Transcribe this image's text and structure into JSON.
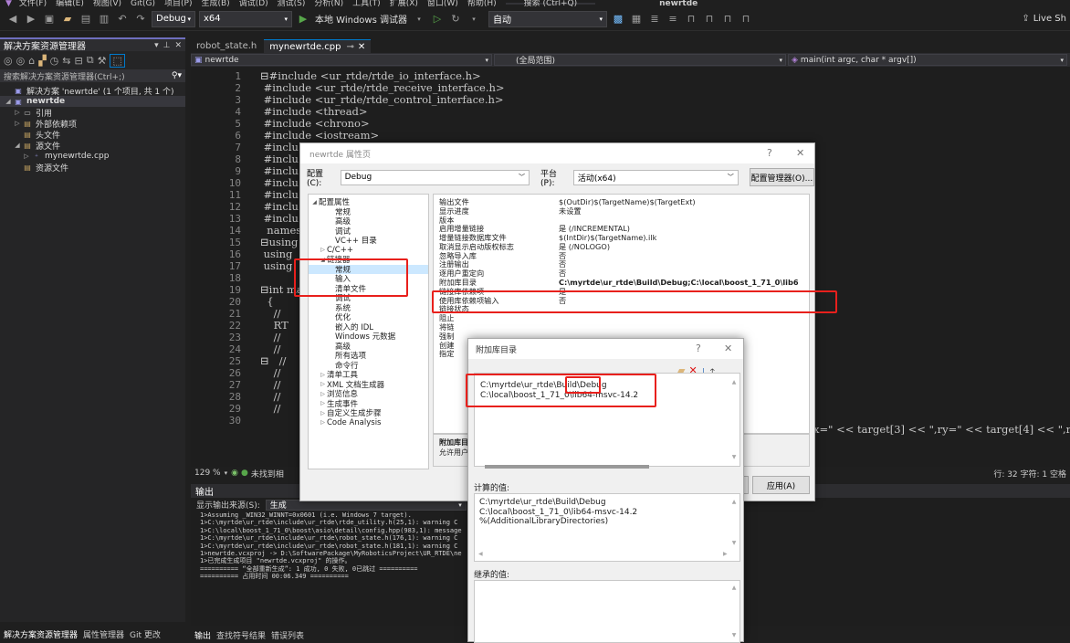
{
  "menubar": {
    "items": [
      "文件(F)",
      "编辑(E)",
      "视图(V)",
      "Git(G)",
      "项目(P)",
      "生成(B)",
      "调试(D)",
      "测试(S)",
      "分析(N)",
      "工具(T)",
      "扩展(X)",
      "窗口(W)",
      "帮助(H)",
      "搜索 (Ctrl+Q)",
      "newrtde"
    ]
  },
  "toolbar": {
    "config": "Debug",
    "platform": "x64",
    "run_label": "本地 Windows 调试器",
    "auto": "自动",
    "liveshare": "Live Sh"
  },
  "solution": {
    "title": "解决方案资源管理器",
    "search_placeholder": "搜索解决方案资源管理器(Ctrl+;)",
    "items": [
      {
        "label": "解决方案 'newrtde' (1 个项目, 共 1 个)",
        "indent": 0,
        "toggle": "",
        "bold": false
      },
      {
        "label": "newrtde",
        "indent": 0,
        "toggle": "◢",
        "bold": true
      },
      {
        "label": "引用",
        "indent": 1,
        "toggle": "▷",
        "bold": false
      },
      {
        "label": "外部依赖项",
        "indent": 1,
        "toggle": "▷",
        "bold": false
      },
      {
        "label": "头文件",
        "indent": 1,
        "toggle": "",
        "bold": false
      },
      {
        "label": "源文件",
        "indent": 1,
        "toggle": "◢",
        "bold": false
      },
      {
        "label": "mynewrtde.cpp",
        "indent": 2,
        "toggle": "▷",
        "bold": false
      },
      {
        "label": "资源文件",
        "indent": 1,
        "toggle": "",
        "bold": false
      }
    ],
    "bottom_tabs": [
      "解决方案资源管理器",
      "属性管理器",
      "Git 更改"
    ]
  },
  "editor": {
    "tabs": [
      "robot_state.h",
      "mynewrtde.cpp"
    ],
    "nav_project": "newrtde",
    "nav_scope": "(全局范围)",
    "nav_func": "main(int argc, char * argv[])",
    "lines": [
      {
        "n": "1",
        "t": "⊟#include <ur_rtde/rtde_io_interface.h>"
      },
      {
        "n": "2",
        "t": " #include <ur_rtde/rtde_receive_interface.h>"
      },
      {
        "n": "3",
        "t": " #include <ur_rtde/rtde_control_interface.h>"
      },
      {
        "n": "4",
        "t": " #include <thread>"
      },
      {
        "n": "5",
        "t": " #include <chrono>"
      },
      {
        "n": "6",
        "t": " #include <iostream>"
      },
      {
        "n": "7",
        "t": " #inclu"
      },
      {
        "n": "8",
        "t": " #inclu"
      },
      {
        "n": "9",
        "t": " #inclu"
      },
      {
        "n": "10",
        "t": " #inclu"
      },
      {
        "n": "11",
        "t": " #inclu"
      },
      {
        "n": "12",
        "t": " #inclu"
      },
      {
        "n": "13",
        "t": " #inclu"
      },
      {
        "n": "14",
        "t": "  namesp"
      },
      {
        "n": "15",
        "t": "⊟using"
      },
      {
        "n": "16",
        "t": " using"
      },
      {
        "n": "17",
        "t": " using"
      },
      {
        "n": "18",
        "t": ""
      },
      {
        "n": "19",
        "t": "⊟int ma"
      },
      {
        "n": "20",
        "t": "  {"
      },
      {
        "n": "21",
        "t": "    //"
      },
      {
        "n": "22",
        "t": "    RT"
      },
      {
        "n": "23",
        "t": "    //"
      },
      {
        "n": "24",
        "t": "    //"
      },
      {
        "n": "25",
        "t": "⊟   //"
      },
      {
        "n": "26",
        "t": "    //"
      },
      {
        "n": "27",
        "t": "    //"
      },
      {
        "n": "28",
        "t": "    //"
      },
      {
        "n": "29",
        "t": "    //"
      },
      {
        "n": "30",
        "t": ""
      }
    ],
    "right_code": "x=\" << target[3] << \",ry=\" << target[4] << \",r",
    "zoom": "129 %",
    "status_text": "未找到相",
    "cursor": "行: 32   字符: 1   空格"
  },
  "output": {
    "title": "输出",
    "source_label": "显示输出来源(S):",
    "source_value": "生成",
    "lines": [
      "1>Assuming _WIN32_WINNT=0x0601 (i.e. Windows 7 target).",
      "1>C:\\myrtde\\ur_rtde\\include\\ur_rtde\\rtde_utility.h(25,1): warning C",
      "1>C:\\local\\boost_1_71_0\\boost\\asio\\detail\\config.hpp(983,1): message",
      "1>C:\\myrtde\\ur_rtde\\include\\ur_rtde\\robot_state.h(176,1): warning C",
      "1>C:\\myrtde\\ur_rtde\\include\\ur_rtde\\robot_state.h(181,1): warning C",
      "1>newrtde.vcxproj -> D:\\SoftwarePackage\\MyRoboticsProject\\UR_RTDE\\ne",
      "1>已完成生成项目 \"newrtde.vcxproj\" 的操作。",
      "========== “全部重新生成”: 1 成功, 0 失败, 0已跳过 ==========",
      "========== 占用时间 00:06.349 =========="
    ],
    "tabs": [
      "输出",
      "查找符号结果",
      "错误列表"
    ]
  },
  "property_dialog": {
    "title": "newrtde 属性页",
    "config_label": "配置(C):",
    "config_value": "Debug",
    "platform_label": "平台(P):",
    "platform_value": "活动(x64)",
    "config_manager": "配置管理器(O)...",
    "apply": "应用(A)",
    "tree": [
      {
        "label": "配置属性",
        "indent": 0,
        "toggle": "◢"
      },
      {
        "label": "常规",
        "indent": 2,
        "toggle": ""
      },
      {
        "label": "高级",
        "indent": 2,
        "toggle": ""
      },
      {
        "label": "调试",
        "indent": 2,
        "toggle": ""
      },
      {
        "label": "VC++ 目录",
        "indent": 2,
        "toggle": ""
      },
      {
        "label": "C/C++",
        "indent": 1,
        "toggle": "▷"
      },
      {
        "label": "链接器",
        "indent": 1,
        "toggle": "◢"
      },
      {
        "label": "常规",
        "indent": 2,
        "toggle": "",
        "selected": true
      },
      {
        "label": "输入",
        "indent": 2,
        "toggle": ""
      },
      {
        "label": "清单文件",
        "indent": 2,
        "toggle": ""
      },
      {
        "label": "调试",
        "indent": 2,
        "toggle": ""
      },
      {
        "label": "系统",
        "indent": 2,
        "toggle": ""
      },
      {
        "label": "优化",
        "indent": 2,
        "toggle": ""
      },
      {
        "label": "嵌入的 IDL",
        "indent": 2,
        "toggle": ""
      },
      {
        "label": "Windows 元数据",
        "indent": 2,
        "toggle": ""
      },
      {
        "label": "高级",
        "indent": 2,
        "toggle": ""
      },
      {
        "label": "所有选项",
        "indent": 2,
        "toggle": ""
      },
      {
        "label": "命令行",
        "indent": 2,
        "toggle": ""
      },
      {
        "label": "清单工具",
        "indent": 1,
        "toggle": "▷"
      },
      {
        "label": "XML 文档生成器",
        "indent": 1,
        "toggle": "▷"
      },
      {
        "label": "浏览信息",
        "indent": 1,
        "toggle": "▷"
      },
      {
        "label": "生成事件",
        "indent": 1,
        "toggle": "▷"
      },
      {
        "label": "自定义生成步骤",
        "indent": 1,
        "toggle": "▷"
      },
      {
        "label": "Code Analysis",
        "indent": 1,
        "toggle": "▷"
      }
    ],
    "props": [
      {
        "k": "输出文件",
        "v": "$(OutDir)$(TargetName)$(TargetExt)"
      },
      {
        "k": "显示进度",
        "v": "未设置"
      },
      {
        "k": "版本",
        "v": ""
      },
      {
        "k": "启用增量链接",
        "v": "是 (/INCREMENTAL)"
      },
      {
        "k": "增量链接数据库文件",
        "v": "$(IntDir)$(TargetName).ilk"
      },
      {
        "k": "取消显示启动版权标志",
        "v": "是 (/NOLOGO)"
      },
      {
        "k": "忽略导入库",
        "v": "否"
      },
      {
        "k": "注册输出",
        "v": "否"
      },
      {
        "k": "逐用户重定向",
        "v": "否"
      },
      {
        "k": "附加库目录",
        "v": "C:\\myrtde\\ur_rtde\\Build\\Debug;C:\\local\\boost_1_71_0\\lib6",
        "selected": true
      },
      {
        "k": "链接库依赖项",
        "v": "是"
      },
      {
        "k": "使用库依赖项输入",
        "v": "否"
      },
      {
        "k": "链接状态",
        "v": ""
      },
      {
        "k": "阻止",
        "v": ""
      },
      {
        "k": "将链",
        "v": ""
      },
      {
        "k": "强制",
        "v": ""
      },
      {
        "k": "创建",
        "v": ""
      },
      {
        "k": "指定",
        "v": ""
      }
    ],
    "desc_title": "附加库目",
    "desc_text": "允许用户"
  },
  "lib_dialog": {
    "title": "附加库目录",
    "entries": [
      "C:\\myrtde\\ur_rtde\\Build\\Debug",
      "C:\\local\\boost_1_71_0\\lib64-msvc-14.2"
    ],
    "calc_label": "计算的值:",
    "calc_values": [
      "C:\\myrtde\\ur_rtde\\Build\\Debug",
      "C:\\local\\boost_1_71_0\\lib64-msvc-14.2",
      "%(AdditionalLibraryDirectories)"
    ],
    "inherited_label": "继承的值:"
  },
  "colors": {
    "accent": "#007acc",
    "highlight": "#e8201c",
    "selection": "#cce8ff"
  }
}
